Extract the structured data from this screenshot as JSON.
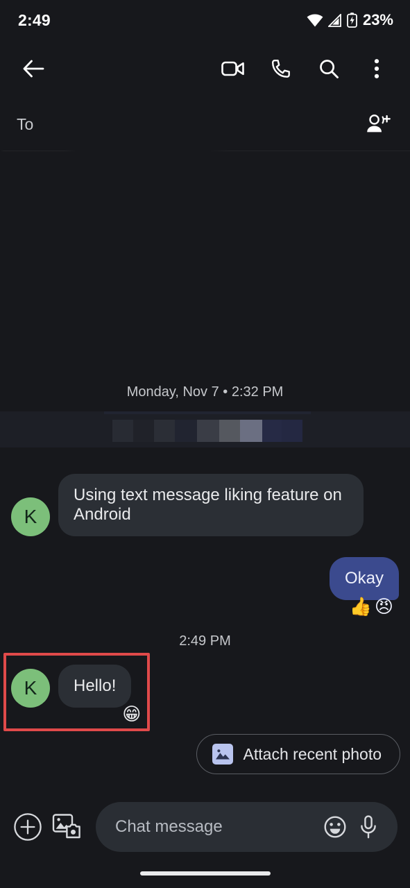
{
  "status_bar": {
    "clock": "2:49",
    "battery_percent": "23%",
    "icons": [
      "wifi-icon",
      "cellular-signal-icon",
      "battery-charging-icon"
    ]
  },
  "app_bar": {
    "back_label": "back-arrow-icon",
    "actions": [
      {
        "name": "video-call-icon",
        "label": "Video call"
      },
      {
        "name": "voice-call-icon",
        "label": "Call"
      },
      {
        "name": "search-icon",
        "label": "Search"
      },
      {
        "name": "overflow-menu-icon",
        "label": "More options"
      }
    ]
  },
  "recipient_row": {
    "to_label": "To",
    "recipient_name": "",
    "add_people_icon": "add-person-icon"
  },
  "conversation": {
    "day_separator": "Monday, Nov 7 • 2:32 PM",
    "messages": [
      {
        "id": "m1",
        "direction": "incoming",
        "avatar_initial": "K",
        "text": "Using text message liking feature on Android",
        "reactions": []
      },
      {
        "id": "m2",
        "direction": "outgoing",
        "text": "Okay",
        "reactions": [
          "👍",
          "😠"
        ]
      },
      {
        "id": "m3",
        "direction": "incoming",
        "avatar_initial": "K",
        "text": "Hello!",
        "reactions": [
          "😁"
        ],
        "highlighted": true
      }
    ],
    "inline_timestamp": "2:49 PM"
  },
  "suggestion_chip": {
    "label": "Attach recent photo",
    "icon": "image-icon"
  },
  "composer": {
    "placeholder": "Chat message",
    "value": "",
    "plus_icon": "plus-circle-icon",
    "gallery_icon": "gallery-camera-icon",
    "emoji_icon": "emoji-smiley-icon",
    "mic_icon": "microphone-icon"
  },
  "colors": {
    "background": "#17181c",
    "incoming_bubble": "#2b2f35",
    "outgoing_bubble": "#3b4a8e",
    "avatar": "#7cbf7a",
    "highlight_border": "#e04a4a",
    "chip_icon": "#b9c4ee"
  }
}
